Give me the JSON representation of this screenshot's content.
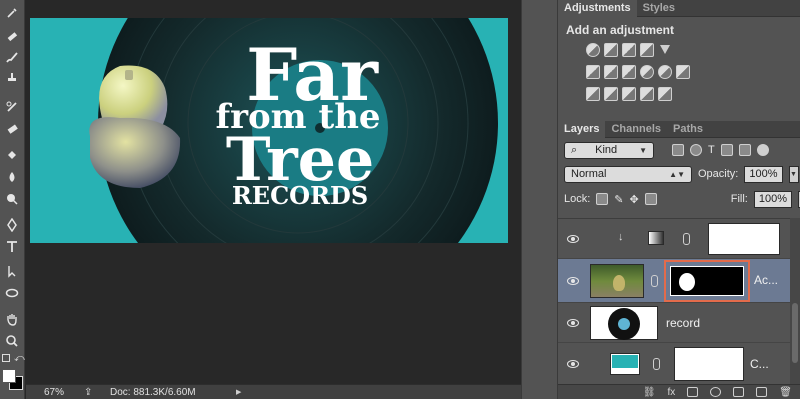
{
  "status_bar": {
    "zoom": "67%",
    "doc_info": "Doc: 881.3K/6.60M"
  },
  "artwork": {
    "line1": "Far",
    "line2": "from the",
    "line3": "Tree",
    "line4": "RECORDS"
  },
  "adjustments_panel": {
    "tabs": [
      "Adjustments",
      "Styles"
    ],
    "title": "Add an adjustment"
  },
  "layers_panel": {
    "tabs": [
      "Layers",
      "Channels",
      "Paths"
    ],
    "filter_kind": "Kind",
    "blend_mode": "Normal",
    "opacity_label": "Opacity:",
    "opacity_value": "100%",
    "lock_label": "Lock:",
    "fill_label": "Fill:",
    "fill_value": "100%",
    "layers": [
      {
        "name": "",
        "type": "adjustment-gradient"
      },
      {
        "name": "Ac...",
        "type": "masked-photo",
        "selected": true
      },
      {
        "name": "record",
        "type": "image"
      },
      {
        "name": "C...",
        "type": "color-fill"
      }
    ]
  },
  "colors": {
    "panel_bg": "#535353",
    "canvas_bg": "#282828",
    "doc_teal": "#28b2b4",
    "highlight": "#e36b4b"
  }
}
